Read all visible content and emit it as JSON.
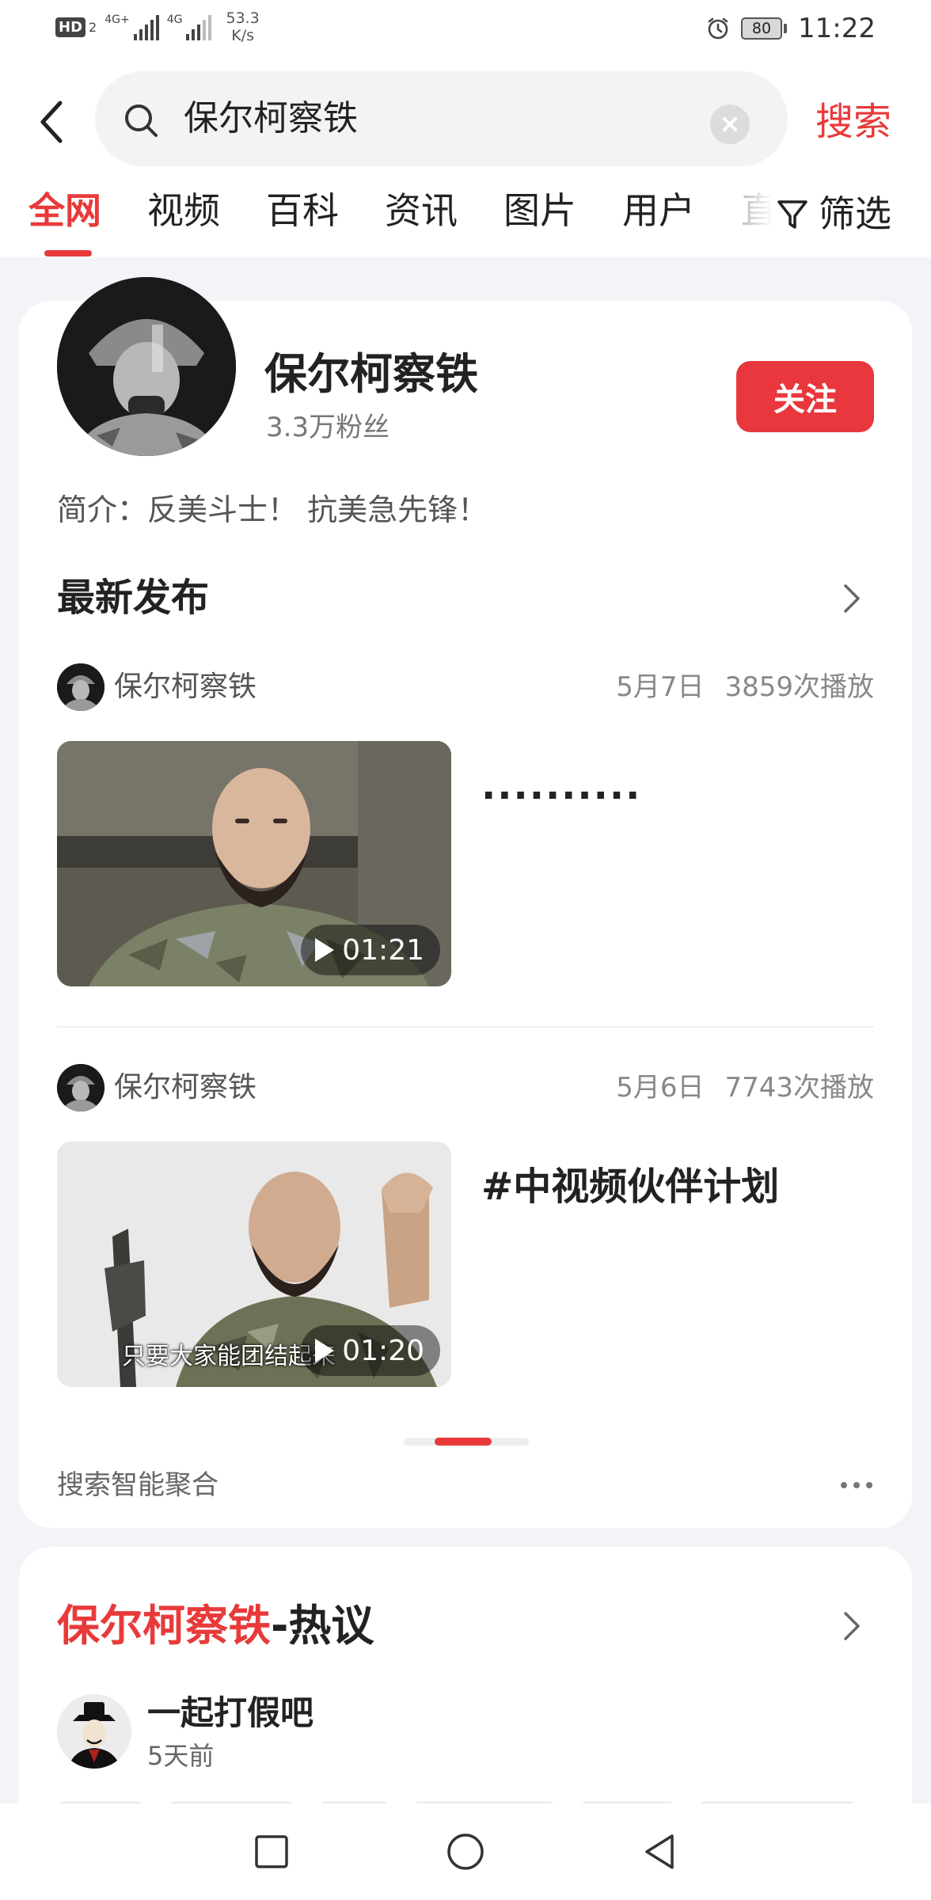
{
  "status_bar": {
    "hd_label": "HD",
    "hd_sub": "2",
    "signal1_label": "4G+",
    "signal2_label": "4G",
    "net_speed_value": "53.3",
    "net_speed_unit": "K/s",
    "battery": "80",
    "time": "11:22"
  },
  "search": {
    "query": "保尔柯察铁",
    "submit_label": "搜索"
  },
  "tabs": [
    "全网",
    "视频",
    "百科",
    "资讯",
    "图片",
    "用户",
    "直"
  ],
  "active_tab_index": 0,
  "filter_label": "筛选",
  "profile": {
    "name": "保尔柯察铁",
    "fans": "3.3万粉丝",
    "follow_label": "关注",
    "bio": "简介：反美斗士！ 抗美急先锋！"
  },
  "latest": {
    "title": "最新发布",
    "posts": [
      {
        "author": "保尔柯察铁",
        "date": "5月7日",
        "plays": "3859次播放",
        "duration": "01:21",
        "title": "..........",
        "caption": ""
      },
      {
        "author": "保尔柯察铁",
        "date": "5月6日",
        "plays": "7743次播放",
        "duration": "01:20",
        "title": "#中视频伙伴计划",
        "caption": "只要大家能团结起来"
      }
    ],
    "carousel_position": 0.45
  },
  "aggregate_label": "搜索智能聚合",
  "hot": {
    "keyword": "保尔柯察铁",
    "suffix": "-热议",
    "author": "一起打假吧",
    "time": "5天前"
  },
  "colors": {
    "accent": "#e83a3a",
    "follow": "#e8383d",
    "page_bg": "#f2f4f7"
  },
  "icons": {
    "back": "chevron-left-icon",
    "search": "search-icon",
    "clear": "clear-icon",
    "filter": "filter-icon",
    "more": "chevron-right-icon",
    "play": "play-icon",
    "nav": [
      "square-icon",
      "circle-icon",
      "triangle-back-icon"
    ]
  }
}
